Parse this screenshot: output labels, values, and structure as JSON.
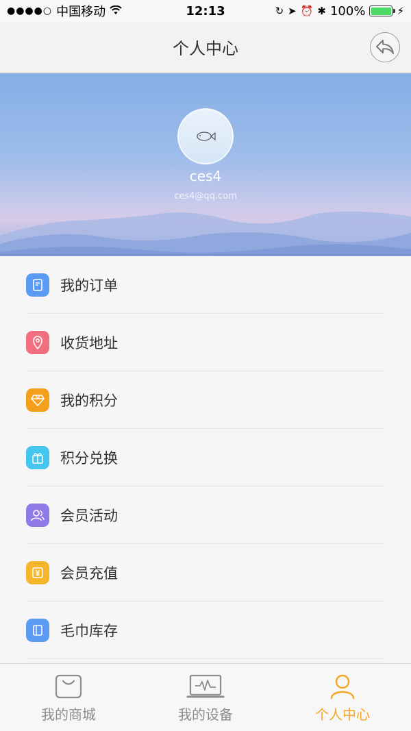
{
  "status_bar": {
    "carrier": "中国移动",
    "time": "12:13",
    "battery": "100%",
    "battery_level": 1.0
  },
  "nav": {
    "title": "个人中心",
    "back_icon": "back-arrow-icon"
  },
  "profile": {
    "username": "ces4",
    "email": "ces4@qq.com"
  },
  "menu": {
    "items": [
      {
        "label": "我的订单",
        "icon": "order-icon",
        "color": "#5b9bf3"
      },
      {
        "label": "收货地址",
        "icon": "location-pin-icon",
        "color": "#f36f80"
      },
      {
        "label": "我的积分",
        "icon": "diamond-icon",
        "color": "#f5a01c"
      },
      {
        "label": "积分兑换",
        "icon": "gift-icon",
        "color": "#45c6ee"
      },
      {
        "label": "会员活动",
        "icon": "members-icon",
        "color": "#8f7ae8"
      },
      {
        "label": "会员充值",
        "icon": "recharge-icon",
        "color": "#f5b62c"
      },
      {
        "label": "毛巾库存",
        "icon": "towel-stock-icon",
        "color": "#5b9bf3"
      }
    ]
  },
  "tabs": [
    {
      "label": "我的商城",
      "icon": "shopping-bag-icon",
      "active": false
    },
    {
      "label": "我的设备",
      "icon": "device-monitor-icon",
      "active": false
    },
    {
      "label": "个人中心",
      "icon": "person-icon",
      "active": true
    }
  ],
  "colors": {
    "accent": "#f5a623",
    "inactive_tab": "#8c8c8c"
  }
}
